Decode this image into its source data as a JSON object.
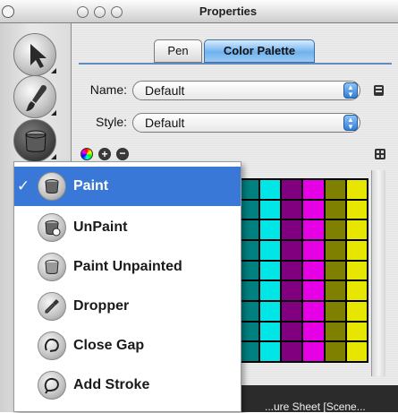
{
  "properties_window": {
    "title": "Properties",
    "tabs": [
      {
        "label": "Pen",
        "active": false
      },
      {
        "label": "Color Palette",
        "active": true
      }
    ],
    "name_field": {
      "label": "Name:",
      "value": "Default"
    },
    "style_field": {
      "label": "Style:",
      "value": "Default"
    }
  },
  "toolbar": {
    "tools": [
      "arrow-tool",
      "brush-tool",
      "paint-bucket-tool"
    ],
    "selected": "paint-bucket-tool"
  },
  "tool_menu": {
    "selected": "Paint",
    "items": [
      {
        "label": "Paint",
        "icon": "paint-bucket-icon",
        "checked": true
      },
      {
        "label": "UnPaint",
        "icon": "unpaint-icon",
        "checked": false
      },
      {
        "label": "Paint Unpainted",
        "icon": "paint-unpainted-icon",
        "checked": false
      },
      {
        "label": "Dropper",
        "icon": "dropper-icon",
        "checked": false
      },
      {
        "label": "Close Gap",
        "icon": "close-gap-icon",
        "checked": false
      },
      {
        "label": "Add Stroke",
        "icon": "add-stroke-icon",
        "checked": false
      }
    ]
  },
  "palette": {
    "column_colors": [
      "#008080",
      "#00e5e5",
      "#800080",
      "#e600e6",
      "#808000",
      "#e6e600"
    ],
    "rows": 9
  },
  "status_bar": {
    "text": "...ure Sheet [Scene..."
  },
  "colors": {
    "menu_highlight": "#3a78d8",
    "tab_active": "#6fb2ee"
  }
}
